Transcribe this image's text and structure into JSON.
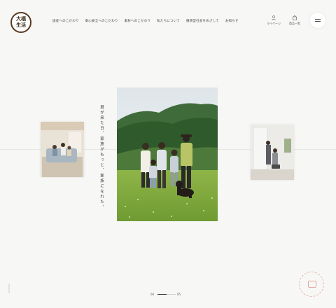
{
  "brand": {
    "logo_text": "大福\n生活"
  },
  "nav": {
    "items": [
      {
        "label": "国産へのこだわり"
      },
      {
        "label": "安心安全へのこだわり"
      },
      {
        "label": "素材へのこだわり"
      },
      {
        "label": "私たちについて"
      },
      {
        "label": "循環型社会をめざして"
      },
      {
        "label": "お知らせ"
      }
    ]
  },
  "utility": {
    "mypage_label": "マイページ",
    "products_label": "商品一覧"
  },
  "hero": {
    "vertical_copy": "君が来た日、家族がもっと、家族になれた。"
  },
  "pager": {
    "current": "04",
    "total": "05",
    "progress": 0.5
  },
  "colors": {
    "background": "#f7f7f5",
    "logo_ring": "#5a3a22",
    "stamp": "#e3b6b0"
  },
  "icons": {
    "mypage": "person-icon",
    "products": "bag-icon",
    "menu": "hamburger-icon"
  }
}
